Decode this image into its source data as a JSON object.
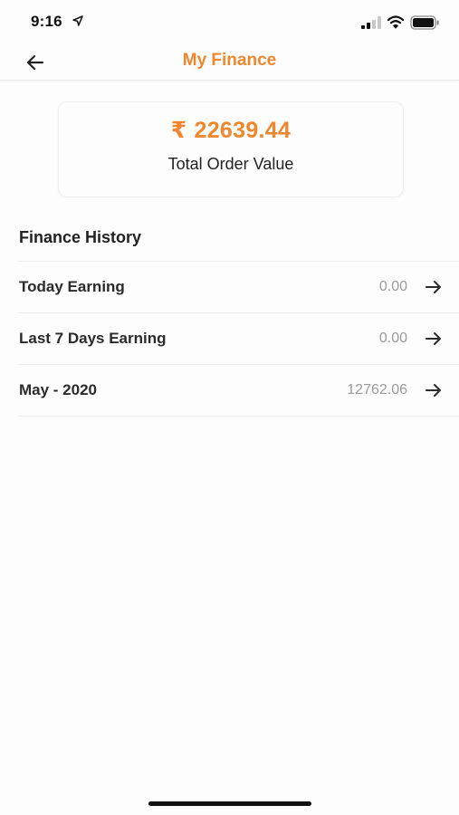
{
  "status_bar": {
    "time": "9:16",
    "icons": [
      "location-arrow-icon",
      "cellular-signal-icon",
      "wifi-icon",
      "battery-icon"
    ]
  },
  "header": {
    "title": "My Finance",
    "back_icon": "arrow-left-icon"
  },
  "summary": {
    "currency_symbol": "₹",
    "amount": "22639.44",
    "label": "Total Order Value"
  },
  "finance_history": {
    "title": "Finance History",
    "rows": [
      {
        "label": "Today Earning",
        "value": "0.00"
      },
      {
        "label": "Last 7 Days Earning",
        "value": "0.00"
      },
      {
        "label": "May - 2020",
        "value": "12762.06"
      }
    ]
  },
  "colors": {
    "accent": "#f0872d",
    "text": "#2b2b2b",
    "muted": "#9a9a9a",
    "divider": "#ededed"
  }
}
